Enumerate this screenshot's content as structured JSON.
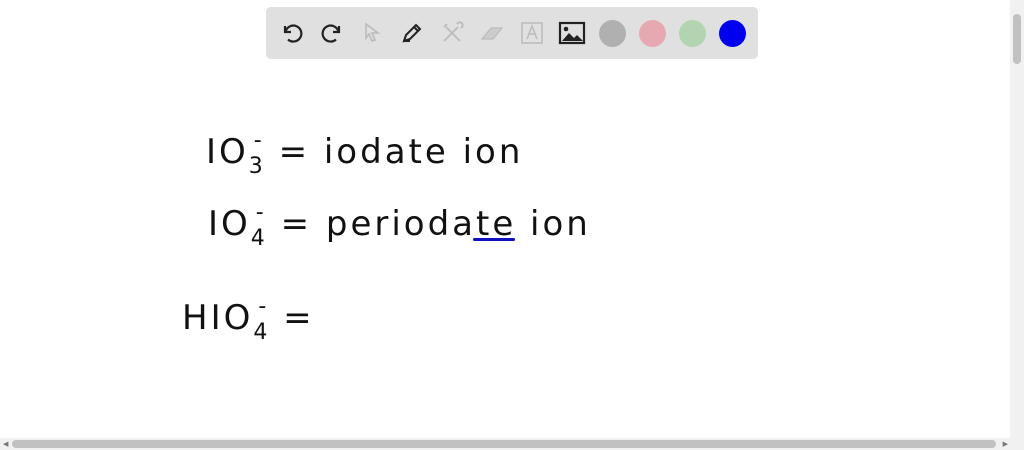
{
  "toolbar": {
    "tools": [
      "undo-icon",
      "redo-icon",
      "select-icon",
      "pen-icon",
      "tools-icon",
      "eraser-icon",
      "text-icon",
      "image-icon"
    ],
    "colors": [
      "#b0b0b0",
      "#e6a9b1",
      "#b3d4b0",
      "#0000ee"
    ]
  },
  "canvas": {
    "line1": {
      "base": "IO",
      "sub": "3",
      "sup": "-",
      "rest": "= iodate ion"
    },
    "line2": {
      "base": "IO",
      "sub": "4",
      "sup": "-",
      "rest": "= periodate ion"
    },
    "line3": {
      "base": "HIO",
      "sub": "4",
      "sup": "-",
      "rest": "="
    }
  }
}
